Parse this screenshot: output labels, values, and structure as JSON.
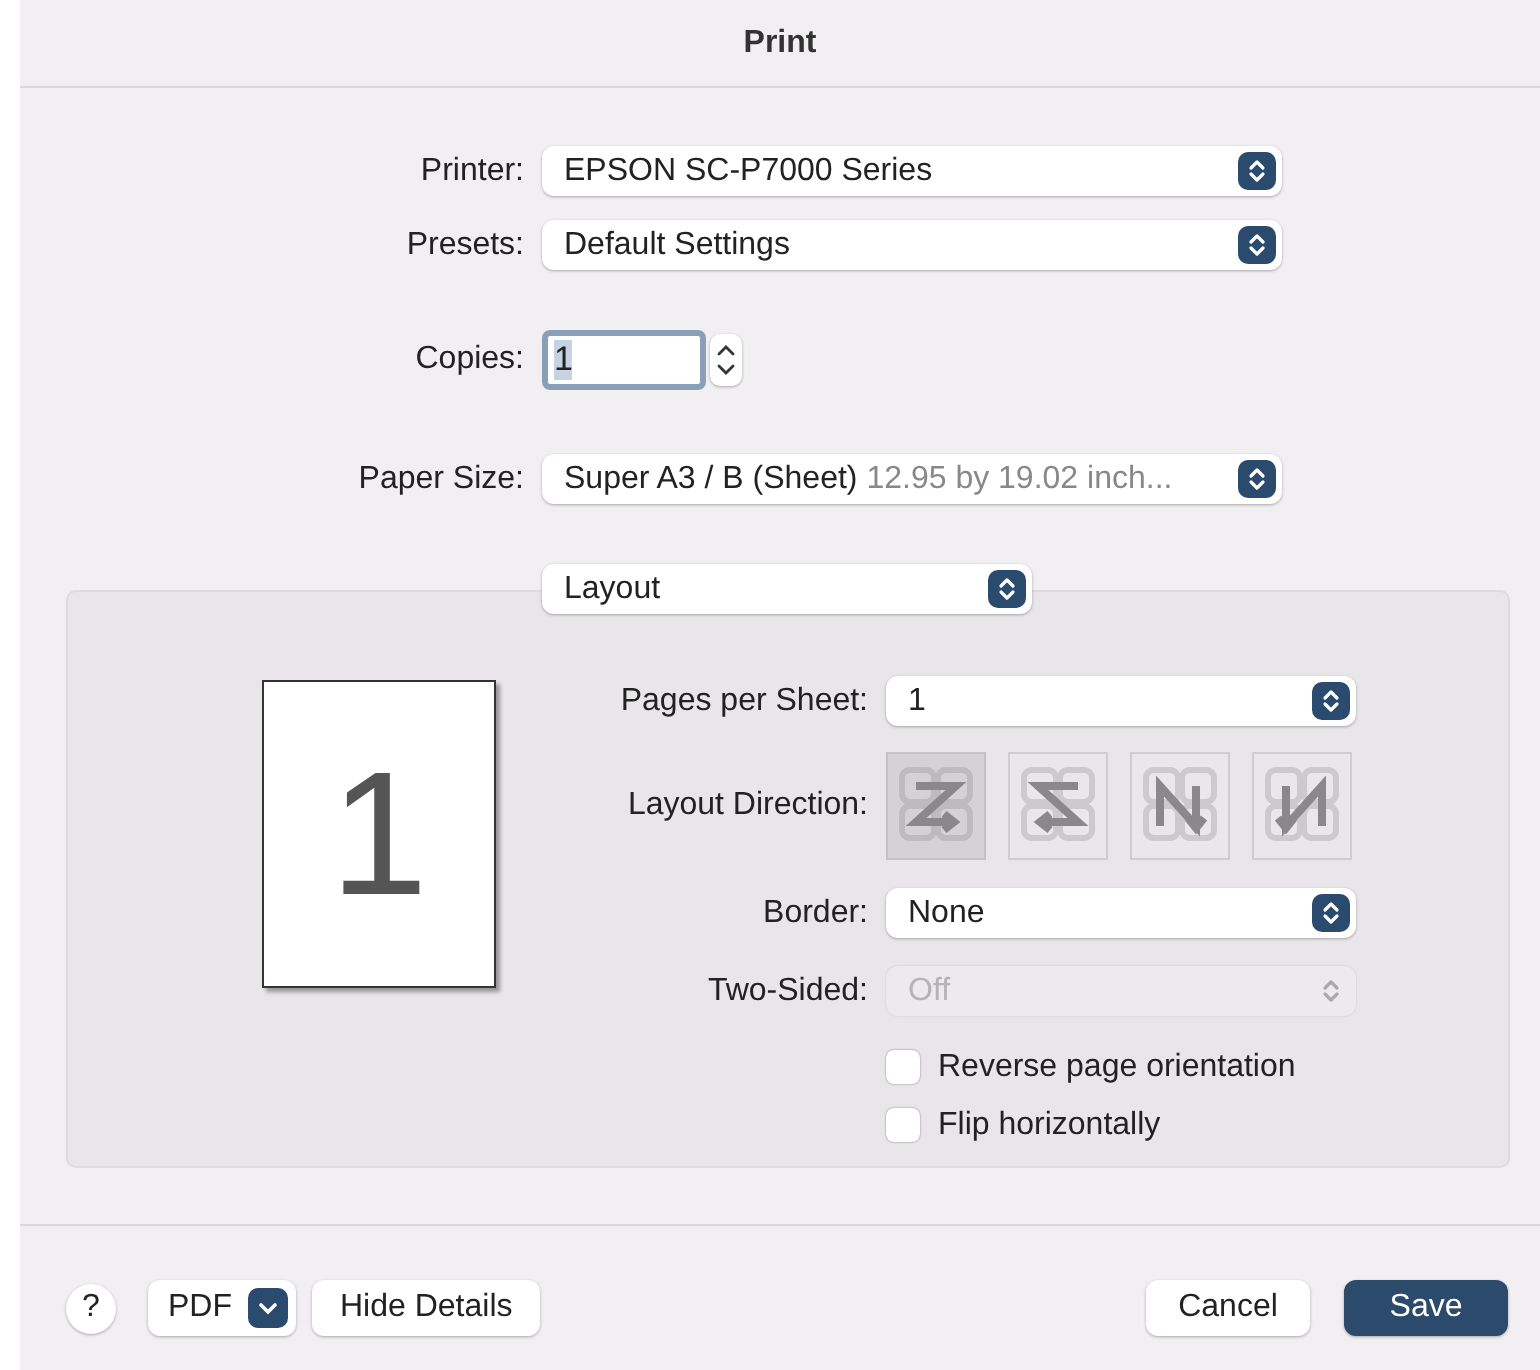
{
  "window": {
    "title": "Print"
  },
  "printer": {
    "label": "Printer:",
    "value": "EPSON SC-P7000 Series"
  },
  "presets": {
    "label": "Presets:",
    "value": "Default Settings"
  },
  "copies": {
    "label": "Copies:",
    "value": "1"
  },
  "paper_size": {
    "label": "Paper Size:",
    "value": "Super A3 / B (Sheet)",
    "detail": "12.95 by 19.02 inch..."
  },
  "section": {
    "value": "Layout"
  },
  "preview": {
    "page_number": "1"
  },
  "pages_per_sheet": {
    "label": "Pages per Sheet:",
    "value": "1"
  },
  "layout_direction": {
    "label": "Layout Direction:",
    "options": [
      {
        "kind": "z",
        "selected": true
      },
      {
        "kind": "s",
        "selected": false
      },
      {
        "kind": "n-reverse",
        "selected": false
      },
      {
        "kind": "n",
        "selected": false
      }
    ]
  },
  "border": {
    "label": "Border:",
    "value": "None"
  },
  "two_sided": {
    "label": "Two-Sided:",
    "value": "Off",
    "disabled": true
  },
  "checkboxes": [
    {
      "label": "Reverse page orientation",
      "checked": false
    },
    {
      "label": "Flip horizontally",
      "checked": false
    }
  ],
  "footer": {
    "help": "?",
    "pdf": "PDF",
    "hide_details": "Hide Details",
    "cancel": "Cancel",
    "save": "Save"
  }
}
